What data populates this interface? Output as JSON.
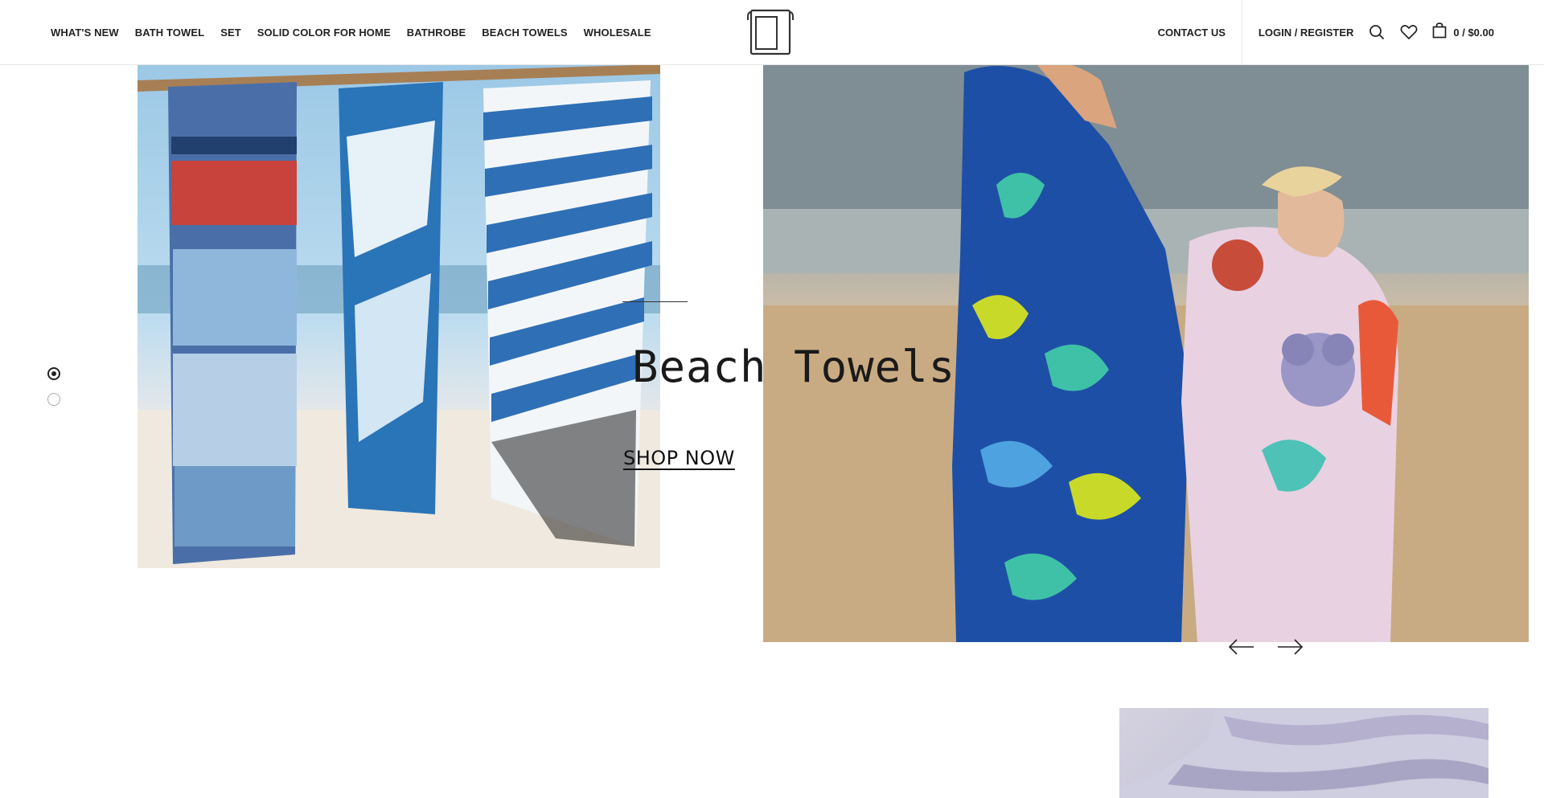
{
  "nav": {
    "items": [
      "WHAT'S NEW",
      "BATH TOWEL",
      "SET",
      "SOLID COLOR FOR HOME",
      "BATHROBE",
      "BEACH TOWELS",
      "WHOLESALE"
    ]
  },
  "header": {
    "contact_label": "CONTACT US",
    "login_label": "LOGIN / REGISTER",
    "cart_total": "0 / $0.00"
  },
  "icons": {
    "logo": "towel-logo-icon",
    "search": "search-icon",
    "wishlist": "heart-icon",
    "cart": "shopping-bag-icon",
    "prev": "arrow-left-icon",
    "next": "arrow-right-icon"
  },
  "hero": {
    "title": "Beach Towels",
    "cta_label": "SHOP NOW",
    "slides_total": 2,
    "active_slide": 1
  }
}
